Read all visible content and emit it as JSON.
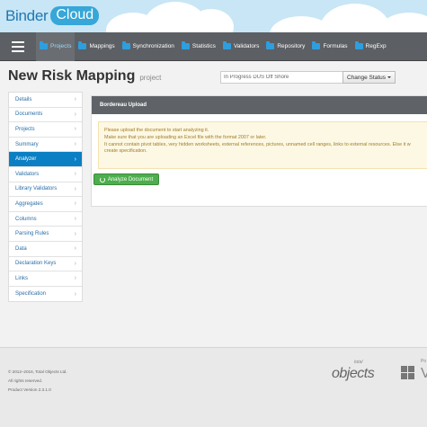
{
  "brand": {
    "name": "Binder",
    "suffix": "Cloud"
  },
  "nav": {
    "items": [
      {
        "label": "Projects",
        "icon": "folder-icon"
      },
      {
        "label": "Mappings",
        "icon": "folder-icon"
      },
      {
        "label": "Synchronization",
        "icon": "folder-icon"
      },
      {
        "label": "Statistics",
        "icon": "folder-icon"
      },
      {
        "label": "Validators",
        "icon": "folder-icon"
      },
      {
        "label": "Repository",
        "icon": "folder-icon"
      },
      {
        "label": "Formulas",
        "icon": "folder-icon"
      },
      {
        "label": "RegExp",
        "icon": "folder-icon"
      }
    ],
    "active": "Projects"
  },
  "page": {
    "title": "New Risk Mapping",
    "subtitle": "project"
  },
  "status": {
    "value": "In Progress DUS Off Shore",
    "button_label": "Change Status"
  },
  "sidebar": {
    "items": [
      {
        "label": "Details"
      },
      {
        "label": "Documents"
      },
      {
        "label": "Projects"
      },
      {
        "label": "Summary"
      },
      {
        "label": "Analyzer"
      },
      {
        "label": "Validators"
      },
      {
        "label": "Library Validators"
      },
      {
        "label": "Aggregates"
      },
      {
        "label": "Columns"
      },
      {
        "label": "Parsing Rules"
      },
      {
        "label": "Data"
      },
      {
        "label": "Declaration Keys"
      },
      {
        "label": "Links"
      },
      {
        "label": "Specification"
      }
    ],
    "active": "Analyzer"
  },
  "panel": {
    "title": "Bordereau Upload",
    "alert_lines": [
      "Please upload the document to start analyzing it.",
      "Make sure that you are uploading an Excel file with the format 2007 or later.",
      "It cannot contain pivot tables, very hidden worksheets, external references, pictures, unnamed cell ranges, links to external resources. Else it w",
      "create specification."
    ],
    "button_label": "Analyze Document"
  },
  "footer": {
    "copyright": "© 2012–2016, Total Objects Ltd.",
    "rights": "All rights reserved.",
    "version": "Product Version 2.3.1.0",
    "partner_small": "total",
    "partner_logo": "objects",
    "platform_small": "Po",
    "platform_logo": "V"
  },
  "colors": {
    "accent": "#0a7fc4",
    "nav_bg": "#5c5f63",
    "success": "#4cae4c",
    "alert_bg": "#fcf8e3"
  }
}
